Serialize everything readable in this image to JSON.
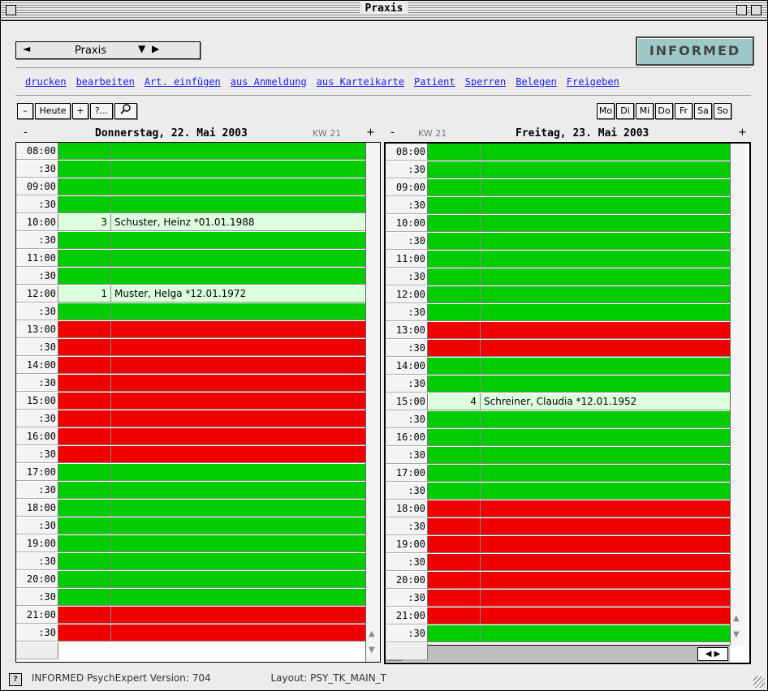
{
  "window": {
    "title": "Praxis"
  },
  "popup": {
    "label": "Praxis",
    "left_arrow": "◄",
    "right_arrows": "▼ ▶"
  },
  "logo": {
    "text": "INFORMED"
  },
  "menu": [
    "drucken",
    "bearbeiten",
    "Art. einfügen",
    "aus Anmeldung",
    "aus Karteikarte",
    "Patient",
    "Sperren",
    "Belegen",
    "Freigeben"
  ],
  "toolbar": {
    "minus": "–",
    "today": "Heute",
    "plus": "+",
    "query": "?...",
    "search_icon": "magnifier-icon"
  },
  "weekdays": [
    "Mo",
    "Di",
    "Mi",
    "Do",
    "Fr",
    "Sa",
    "So"
  ],
  "colors": {
    "free": "#00cc00",
    "blocked": "#ee0000",
    "booked": "#ddffdd",
    "link": "#1a1aff"
  },
  "day1": {
    "date": "Donnerstag, 22. Mai 2003",
    "kw": "KW 21",
    "minus": "-",
    "plus": "+",
    "slots": [
      {
        "time": "08:00",
        "status": "free",
        "num": "",
        "patient": ""
      },
      {
        "time": ":30",
        "status": "free",
        "num": "",
        "patient": ""
      },
      {
        "time": "09:00",
        "status": "free",
        "num": "",
        "patient": ""
      },
      {
        "time": ":30",
        "status": "free",
        "num": "",
        "patient": ""
      },
      {
        "time": "10:00",
        "status": "booked",
        "num": "3",
        "patient": "Schuster, Heinz *01.01.1988"
      },
      {
        "time": ":30",
        "status": "free",
        "num": "",
        "patient": ""
      },
      {
        "time": "11:00",
        "status": "free",
        "num": "",
        "patient": ""
      },
      {
        "time": ":30",
        "status": "free",
        "num": "",
        "patient": ""
      },
      {
        "time": "12:00",
        "status": "booked",
        "num": "1",
        "patient": "Muster, Helga *12.01.1972"
      },
      {
        "time": ":30",
        "status": "free",
        "num": "",
        "patient": ""
      },
      {
        "time": "13:00",
        "status": "blocked",
        "num": "",
        "patient": ""
      },
      {
        "time": ":30",
        "status": "blocked",
        "num": "",
        "patient": ""
      },
      {
        "time": "14:00",
        "status": "blocked",
        "num": "",
        "patient": ""
      },
      {
        "time": ":30",
        "status": "blocked",
        "num": "",
        "patient": ""
      },
      {
        "time": "15:00",
        "status": "blocked",
        "num": "",
        "patient": ""
      },
      {
        "time": ":30",
        "status": "blocked",
        "num": "",
        "patient": ""
      },
      {
        "time": "16:00",
        "status": "blocked",
        "num": "",
        "patient": ""
      },
      {
        "time": ":30",
        "status": "blocked",
        "num": "",
        "patient": ""
      },
      {
        "time": "17:00",
        "status": "free",
        "num": "",
        "patient": ""
      },
      {
        "time": ":30",
        "status": "free",
        "num": "",
        "patient": ""
      },
      {
        "time": "18:00",
        "status": "free",
        "num": "",
        "patient": ""
      },
      {
        "time": ":30",
        "status": "free",
        "num": "",
        "patient": ""
      },
      {
        "time": "19:00",
        "status": "free",
        "num": "",
        "patient": ""
      },
      {
        "time": ":30",
        "status": "free",
        "num": "",
        "patient": ""
      },
      {
        "time": "20:00",
        "status": "free",
        "num": "",
        "patient": ""
      },
      {
        "time": ":30",
        "status": "free",
        "num": "",
        "patient": ""
      },
      {
        "time": "21:00",
        "status": "blocked",
        "num": "",
        "patient": ""
      },
      {
        "time": ":30",
        "status": "blocked",
        "num": "",
        "patient": ""
      }
    ]
  },
  "day2": {
    "date": "Freitag, 23. Mai 2003",
    "kw": "KW 21",
    "minus": "-",
    "plus": "+",
    "slots": [
      {
        "time": "08:00",
        "status": "free",
        "num": "",
        "patient": ""
      },
      {
        "time": ":30",
        "status": "free",
        "num": "",
        "patient": ""
      },
      {
        "time": "09:00",
        "status": "free",
        "num": "",
        "patient": ""
      },
      {
        "time": ":30",
        "status": "free",
        "num": "",
        "patient": ""
      },
      {
        "time": "10:00",
        "status": "free",
        "num": "",
        "patient": ""
      },
      {
        "time": ":30",
        "status": "free",
        "num": "",
        "patient": ""
      },
      {
        "time": "11:00",
        "status": "free",
        "num": "",
        "patient": ""
      },
      {
        "time": ":30",
        "status": "free",
        "num": "",
        "patient": ""
      },
      {
        "time": "12:00",
        "status": "free",
        "num": "",
        "patient": ""
      },
      {
        "time": ":30",
        "status": "free",
        "num": "",
        "patient": ""
      },
      {
        "time": "13:00",
        "status": "blocked",
        "num": "",
        "patient": ""
      },
      {
        "time": ":30",
        "status": "blocked",
        "num": "",
        "patient": ""
      },
      {
        "time": "14:00",
        "status": "free",
        "num": "",
        "patient": ""
      },
      {
        "time": ":30",
        "status": "free",
        "num": "",
        "patient": ""
      },
      {
        "time": "15:00",
        "status": "booked",
        "num": "4",
        "patient": "Schreiner, Claudia *12.01.1952"
      },
      {
        "time": ":30",
        "status": "free",
        "num": "",
        "patient": ""
      },
      {
        "time": "16:00",
        "status": "free",
        "num": "",
        "patient": ""
      },
      {
        "time": ":30",
        "status": "free",
        "num": "",
        "patient": ""
      },
      {
        "time": "17:00",
        "status": "free",
        "num": "",
        "patient": ""
      },
      {
        "time": ":30",
        "status": "free",
        "num": "",
        "patient": ""
      },
      {
        "time": "18:00",
        "status": "blocked",
        "num": "",
        "patient": ""
      },
      {
        "time": ":30",
        "status": "blocked",
        "num": "",
        "patient": ""
      },
      {
        "time": "19:00",
        "status": "blocked",
        "num": "",
        "patient": ""
      },
      {
        "time": ":30",
        "status": "blocked",
        "num": "",
        "patient": ""
      },
      {
        "time": "20:00",
        "status": "blocked",
        "num": "",
        "patient": ""
      },
      {
        "time": ":30",
        "status": "blocked",
        "num": "",
        "patient": ""
      },
      {
        "time": "21:00",
        "status": "blocked",
        "num": "",
        "patient": ""
      },
      {
        "time": ":30",
        "status": "free",
        "num": "",
        "patient": ""
      }
    ]
  },
  "status": {
    "help": "?",
    "version": "INFORMED PsychExpert Version: 704",
    "layout": "Layout: PSY_TK_MAIN_T"
  }
}
